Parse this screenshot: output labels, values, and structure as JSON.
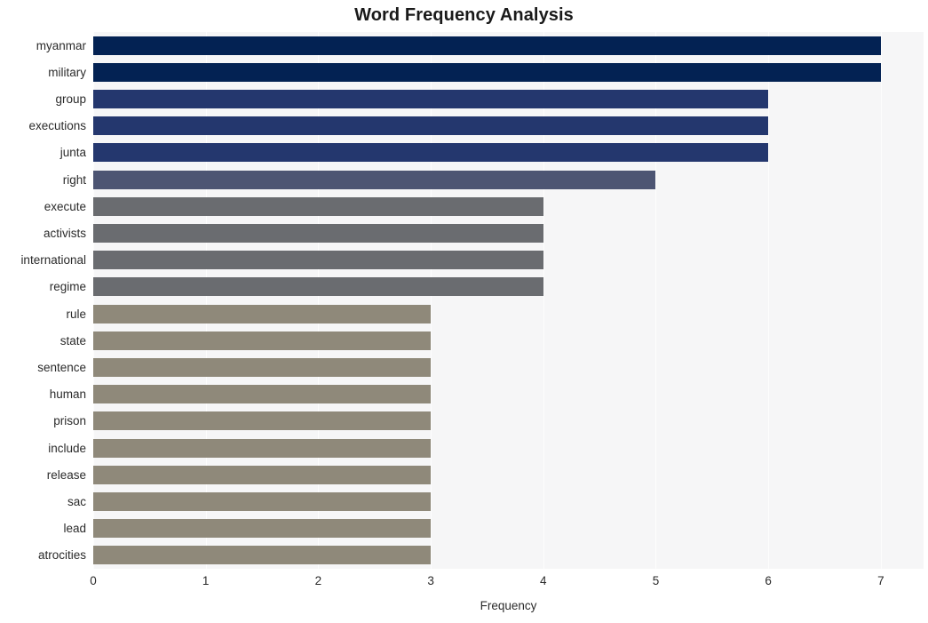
{
  "chart_data": {
    "type": "bar",
    "orientation": "horizontal",
    "title": "Word Frequency Analysis",
    "xlabel": "Frequency",
    "ylabel": "",
    "categories": [
      "myanmar",
      "military",
      "group",
      "executions",
      "junta",
      "right",
      "execute",
      "activists",
      "international",
      "regime",
      "rule",
      "state",
      "sentence",
      "human",
      "prison",
      "include",
      "release",
      "sac",
      "lead",
      "atrocities"
    ],
    "values": [
      7,
      7,
      6,
      6,
      6,
      5,
      4,
      4,
      4,
      4,
      3,
      3,
      3,
      3,
      3,
      3,
      3,
      3,
      3,
      3
    ],
    "bar_colors": [
      "#032253",
      "#032253",
      "#24376e",
      "#24376e",
      "#24376e",
      "#4d5573",
      "#6a6c70",
      "#6a6c70",
      "#6a6c70",
      "#6a6c70",
      "#8f897a",
      "#8f897a",
      "#8f897a",
      "#8f897a",
      "#8f897a",
      "#8f897a",
      "#8f897a",
      "#8f897a",
      "#8f897a",
      "#8f897a"
    ],
    "xlim": [
      0,
      7.38
    ],
    "xticks": [
      0,
      1,
      2,
      3,
      4,
      5,
      6,
      7
    ],
    "xticklabels": [
      "0",
      "1",
      "2",
      "3",
      "4",
      "5",
      "6",
      "7"
    ],
    "grid": true,
    "grid_axis": "x",
    "grid_color": "#fdfdfd",
    "plot_background": "#f6f6f7",
    "figure_background": "#ffffff",
    "legend": null
  }
}
